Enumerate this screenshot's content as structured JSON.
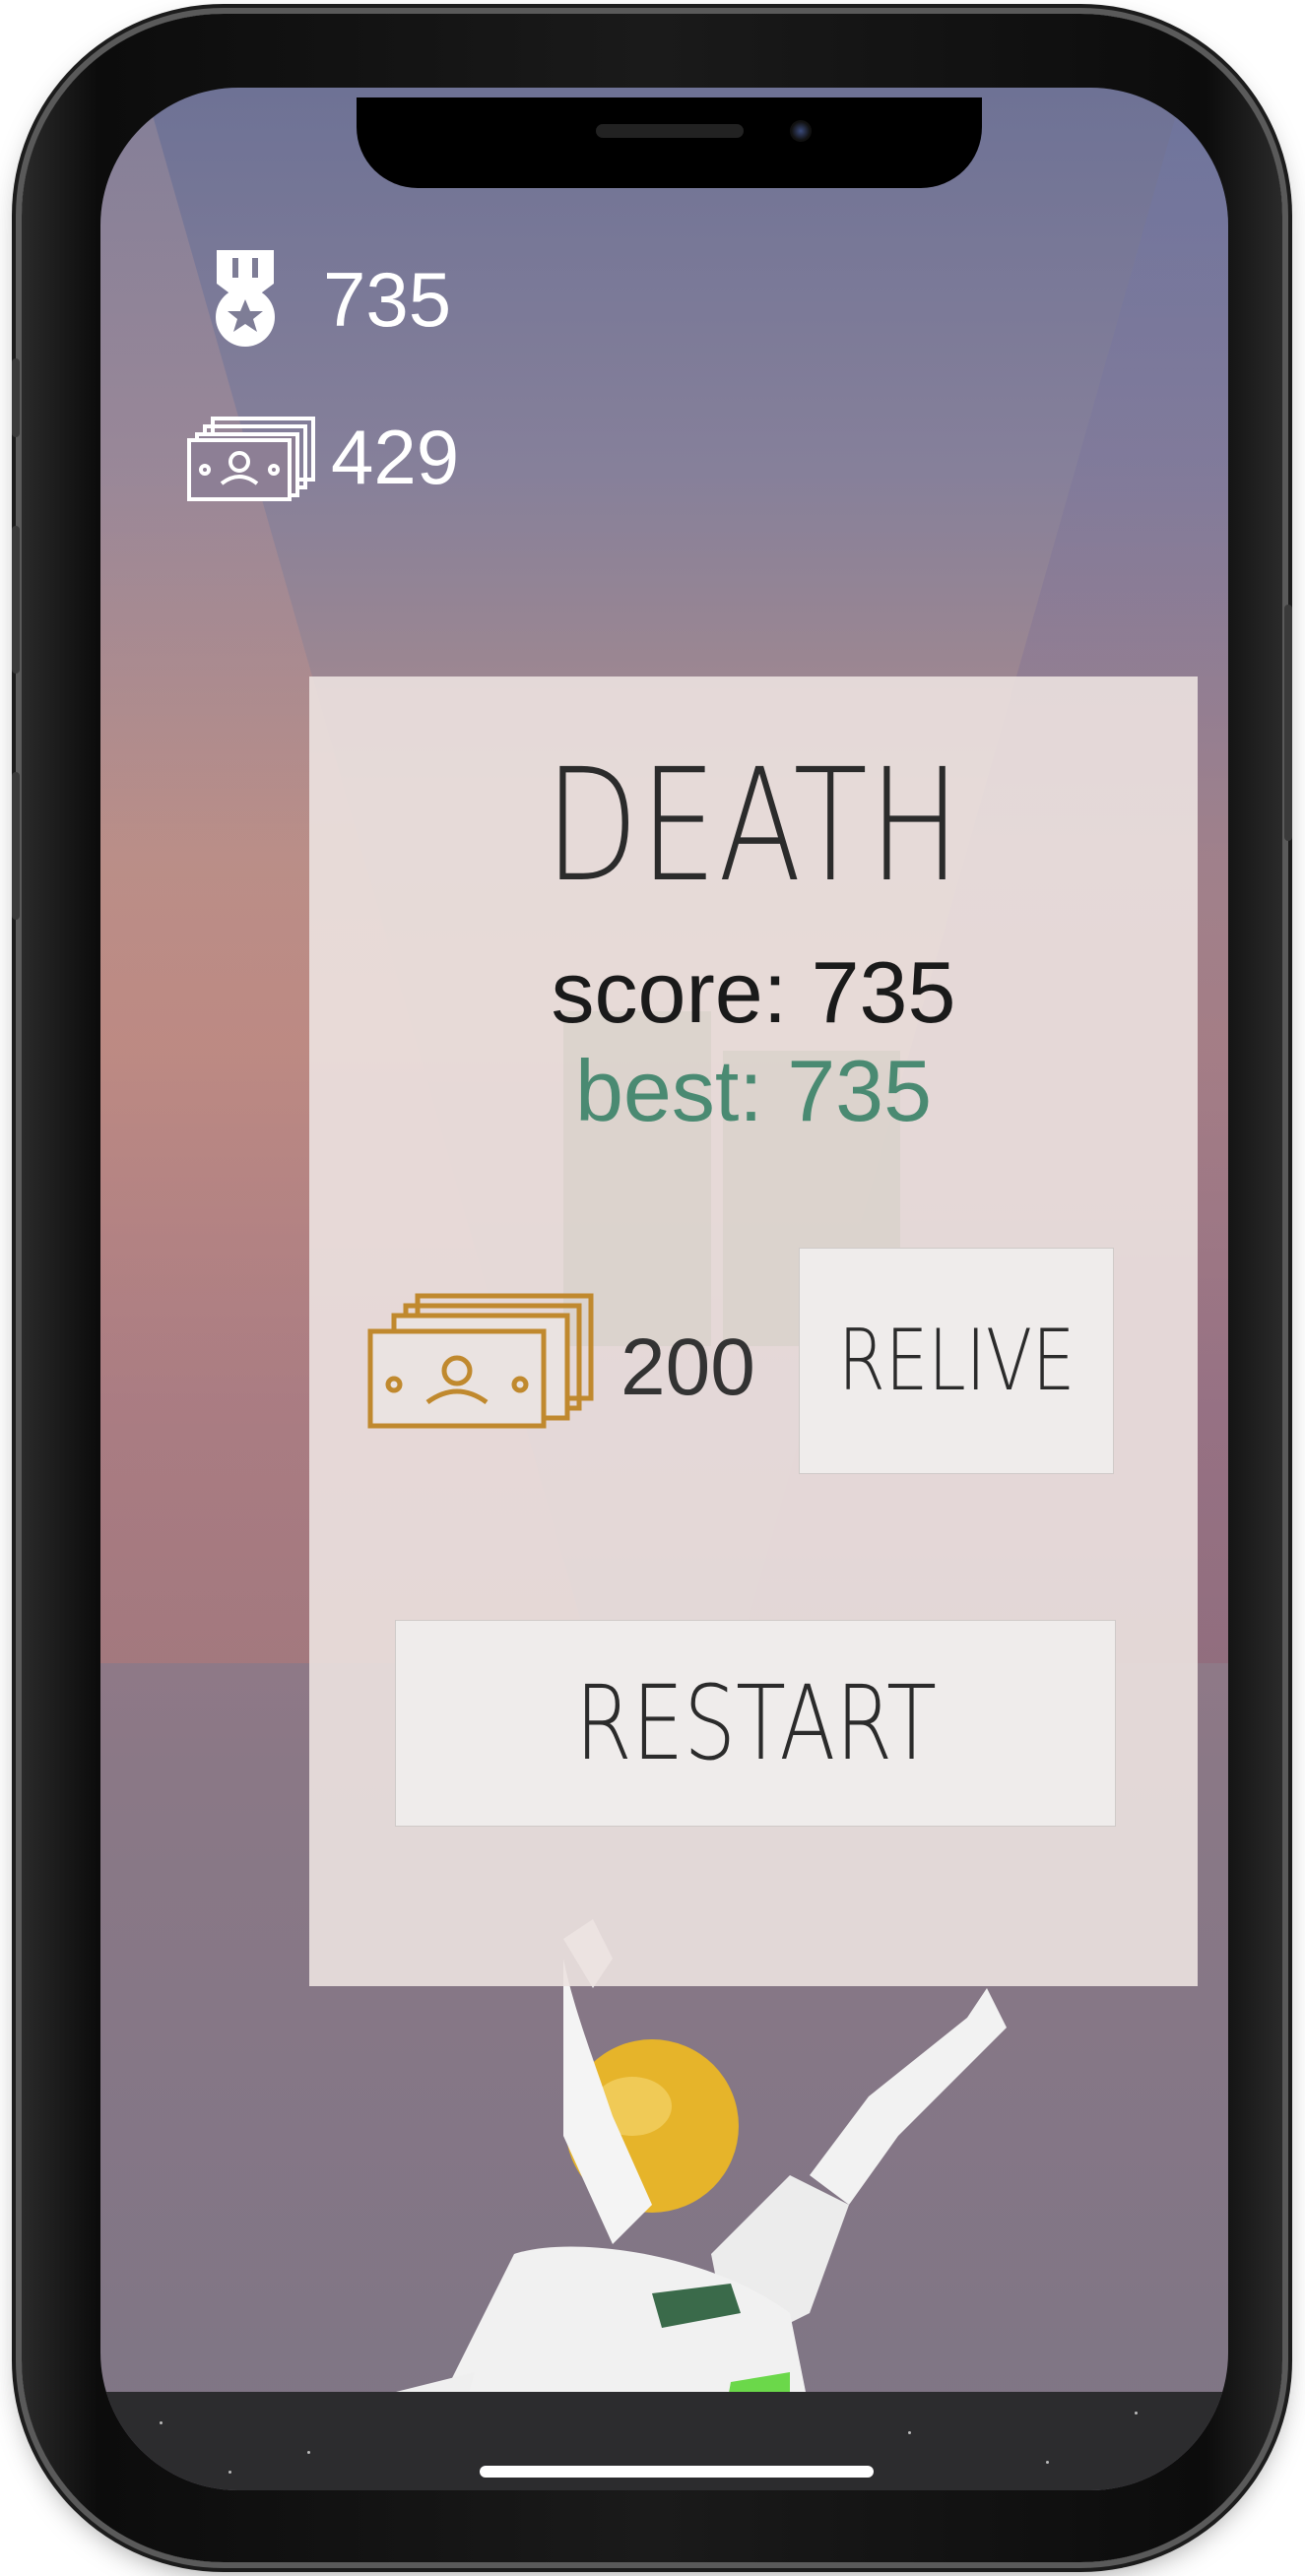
{
  "hud": {
    "medal_icon": "medal-icon",
    "score_value": "735",
    "money_icon": "cash-stack-icon",
    "money_value": "429"
  },
  "dialog": {
    "title": "DEATH",
    "score_text": "score: 735",
    "best_text": "best: 735",
    "relive_cost_icon": "cash-stack-icon",
    "relive_cost": "200",
    "relive_label": "RELIVE",
    "restart_label": "RESTART"
  },
  "colors": {
    "best_text": "#4a8a72",
    "cost_icon": "#c0892e",
    "panel_bg": "#ece2e0"
  }
}
